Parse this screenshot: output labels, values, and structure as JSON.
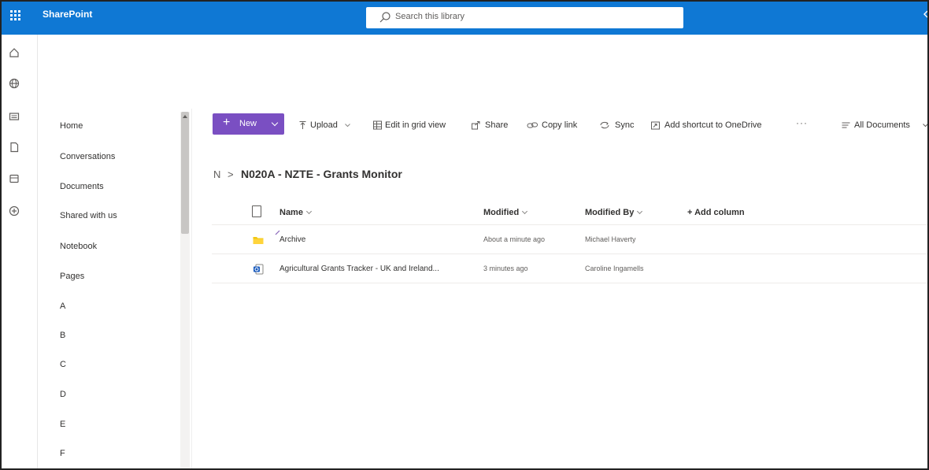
{
  "app": {
    "name": "SharePoint"
  },
  "search": {
    "placeholder": "Search this library"
  },
  "rail": {
    "icons": [
      "home-icon",
      "globe-icon",
      "news-icon",
      "document-icon",
      "lists-icon",
      "add-icon"
    ]
  },
  "nav": {
    "items": [
      "Home",
      "Conversations",
      "Documents",
      "Shared with us",
      "Notebook",
      "Pages",
      "A",
      "B",
      "C",
      "D",
      "E",
      "F"
    ]
  },
  "command": {
    "new": "New",
    "upload": "Upload",
    "edit_grid": "Edit in grid view",
    "share": "Share",
    "copy_link": "Copy link",
    "sync": "Sync",
    "add_shortcut": "Add shortcut to OneDrive",
    "more": "···",
    "view": "All Documents"
  },
  "breadcrumb": {
    "root": "N",
    "separator": ">",
    "current": "N020A - NZTE - Grants Monitor"
  },
  "list": {
    "columns": {
      "name": "Name",
      "modified": "Modified",
      "modified_by": "Modified By",
      "add_column": "+ Add column"
    },
    "rows": [
      {
        "type": "folder",
        "name": "Archive",
        "modified": "About a minute ago",
        "modified_by": "Michael Haverty"
      },
      {
        "type": "document",
        "name": "Agricultural Grants Tracker - UK and Ireland...",
        "modified": "3 minutes ago",
        "modified_by": "Caroline Ingamells"
      }
    ]
  },
  "colors": {
    "suite_bar": "#0f78d4",
    "new_button": "#7a4fc2",
    "folder": "#f2c811",
    "doc_icon": "#185abd"
  }
}
